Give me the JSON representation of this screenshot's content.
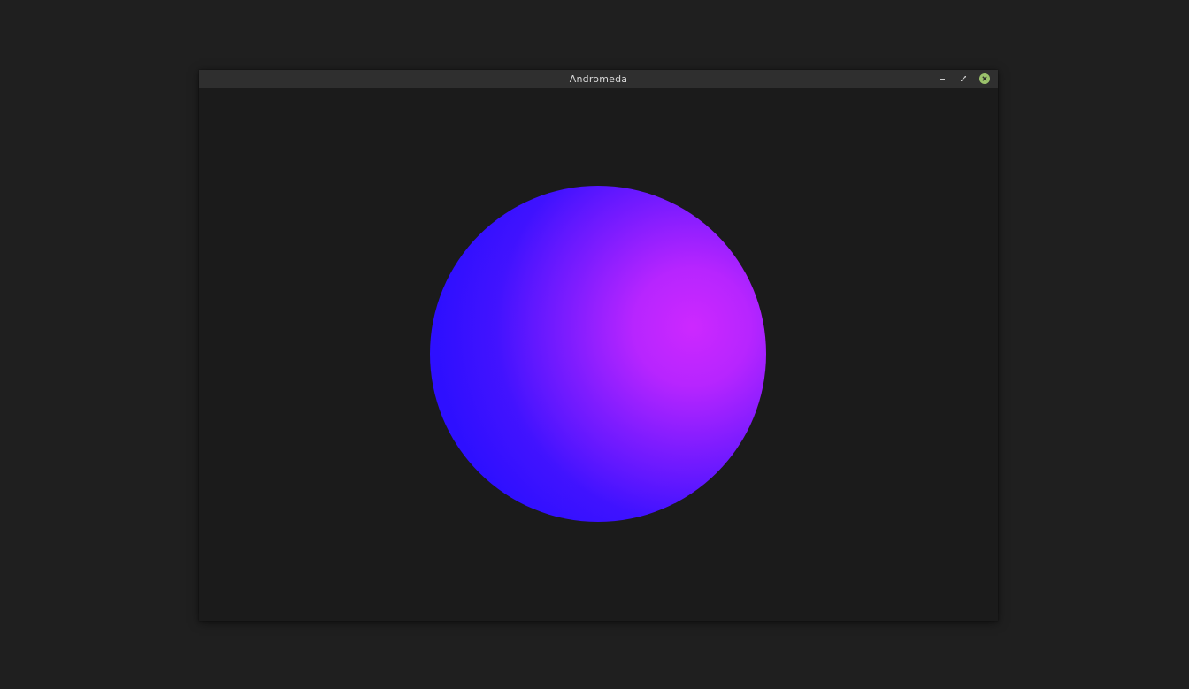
{
  "window": {
    "title": "Andromeda",
    "controls": {
      "minimize_icon": "minimize-icon",
      "restore_icon": "restore-icon",
      "close_icon": "close-icon"
    }
  },
  "scene": {
    "object": "sphere",
    "colors": {
      "shadow": "#2a0eff",
      "highlight": "#cd28ff",
      "background": "#1b1b1b"
    }
  },
  "colors": {
    "desktop": "#1f1f1f",
    "titlebar": "#2f2f2f",
    "title_text": "#d8d8d8",
    "close_button": "#9bc26b"
  }
}
